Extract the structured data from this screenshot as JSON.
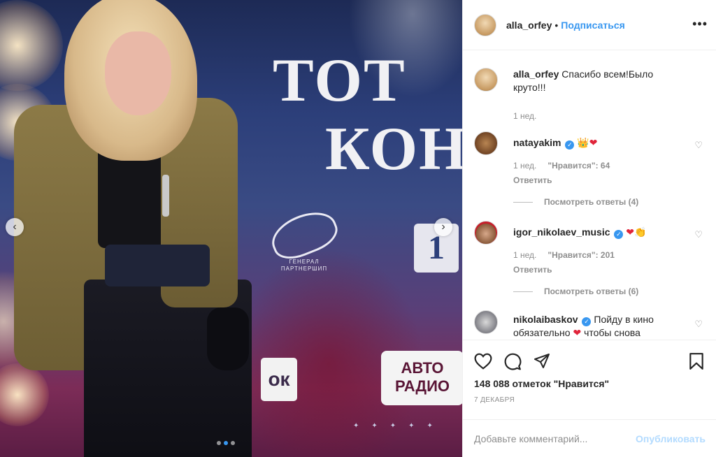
{
  "post": {
    "username": "alla_orfey",
    "separator": "•",
    "follow_label": "Подписаться",
    "more_label": "•••"
  },
  "photo": {
    "poster_line1": "ТОТ",
    "poster_line2": "КОН",
    "partner_caption": "ГЕНЕРАЛ ПАРТНЕРШИП",
    "channel_logo": "1",
    "ok_logo": "ок",
    "radio_logo_line1": "АВТО",
    "radio_logo_line2": "РАДИО",
    "stars": "✦✦✦✦✦",
    "prev_arrow": "‹",
    "next_arrow": "›",
    "carousel_total": 3,
    "carousel_active": 2
  },
  "caption": {
    "username": "alla_orfey",
    "text": "Спасибо всем!Было круто!!!",
    "time": "1 нед."
  },
  "comments": [
    {
      "username": "natayakim",
      "verified": true,
      "emoji": [
        "👑",
        "❤"
      ],
      "time": "1 нед.",
      "likes": "\"Нравится\": 64",
      "reply": "Ответить",
      "view_replies": "Посмотреть ответы (4)"
    },
    {
      "username": "igor_nikolaev_music",
      "verified": true,
      "emoji": [
        "❤",
        "👏"
      ],
      "time": "1 нед.",
      "likes": "\"Нравится\": 201",
      "reply": "Ответить",
      "view_replies": "Посмотреть ответы (6)"
    },
    {
      "username": "nikolaibaskov",
      "verified": true,
      "text_before": "Пойду в кино обязательно",
      "emoji": [
        "❤"
      ],
      "text_after": "чтобы снова окунуться в эту волшебную атмосферу !!!"
    }
  ],
  "verified_mark": "✓",
  "heart_outline": "♡",
  "actions": {
    "likes_count": "148 088 отметок \"Нравится\"",
    "date": "7 декабря"
  },
  "add_comment": {
    "placeholder": "Добавьте комментарий...",
    "publish_label": "Опубликовать"
  }
}
